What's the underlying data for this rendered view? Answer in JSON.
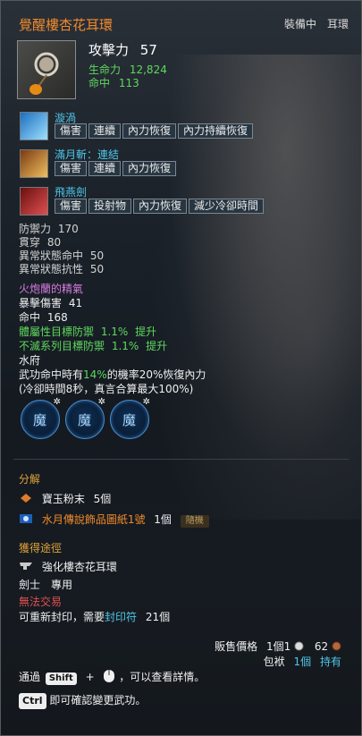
{
  "header": {
    "title": "覺醒樓杏花耳環",
    "status": "裝備中　耳環"
  },
  "main_stat": {
    "label": "攻擊力",
    "value": "57"
  },
  "sub_stats": [
    {
      "label": "生命力",
      "value": "12,824"
    },
    {
      "label": "命中",
      "value": "113"
    }
  ],
  "skills": [
    {
      "name": "漩渦",
      "tags": [
        "傷害",
        "連續",
        "內力恢復",
        "內力持續恢復"
      ]
    },
    {
      "name": "滿月斬：連結",
      "tags": [
        "傷害",
        "連續",
        "內力恢復"
      ]
    },
    {
      "name": "飛燕劍",
      "tags": [
        "傷害",
        "投射物",
        "內力恢復",
        "減少冷卻時間"
      ]
    }
  ],
  "extra_stats": [
    {
      "label": "防禦力",
      "value": "170"
    },
    {
      "label": "貫穿",
      "value": "80"
    },
    {
      "label": "異常狀態命中",
      "value": "50"
    },
    {
      "label": "異常狀態抗性",
      "value": "50"
    }
  ],
  "essence": {
    "title": "火炮蘭的精氣",
    "lines": [
      {
        "label": "暴擊傷害",
        "value": "41"
      },
      {
        "label": "命中",
        "value": "168"
      }
    ],
    "bonus1": {
      "label": "體屬性目標防禦",
      "value": "1.1%",
      "suffix": "提升"
    },
    "bonus2": {
      "label": "不滅系列目標防禦",
      "value": "1.1%",
      "suffix": "提升"
    },
    "set_name": "水府",
    "effect_pre": "武功命中時有",
    "effect_pct": "14%",
    "effect_post": "的機率20%恢復內力",
    "effect_note": "(冷卻時間8秒，真言合算最大100%)"
  },
  "gems": [
    {
      "glyph": "魔",
      "mark": "✲"
    },
    {
      "glyph": "魔",
      "mark": "✲"
    },
    {
      "glyph": "魔",
      "mark": "✲"
    }
  ],
  "decompose": {
    "heading": "分解",
    "items": [
      {
        "name": "寶玉粉末",
        "count": "5個"
      },
      {
        "name": "水月傳說飾品圖紙1號",
        "count": "1個",
        "badge": "隨機"
      }
    ]
  },
  "source": {
    "heading": "獲得途徑",
    "item": "強化樓杏花耳環"
  },
  "class_req": "劍士　專用",
  "trade": {
    "no_trade": "無法交易",
    "reseal_pre": "可重新封印，需要",
    "reseal_item": "封印符",
    "reseal_count": "21個"
  },
  "price": {
    "label": "販售價格",
    "qty": "1個",
    "gold": "1",
    "silver": "62"
  },
  "inventory": {
    "label": "包袱",
    "count": "1個",
    "suffix": "持有"
  },
  "hints": {
    "h1_pre": "通過",
    "shift": "Shift",
    "plus": "+",
    "h1_post": "，可以查看詳情。",
    "ctrl": "Ctrl",
    "h2": "即可確認變更武功。"
  },
  "colors": {
    "title": "#f08a2b",
    "green": "#5fd85f",
    "cyan": "#4fc6e8",
    "purple": "#d77be0",
    "red": "#e0504f",
    "section": "#e0a33a"
  }
}
